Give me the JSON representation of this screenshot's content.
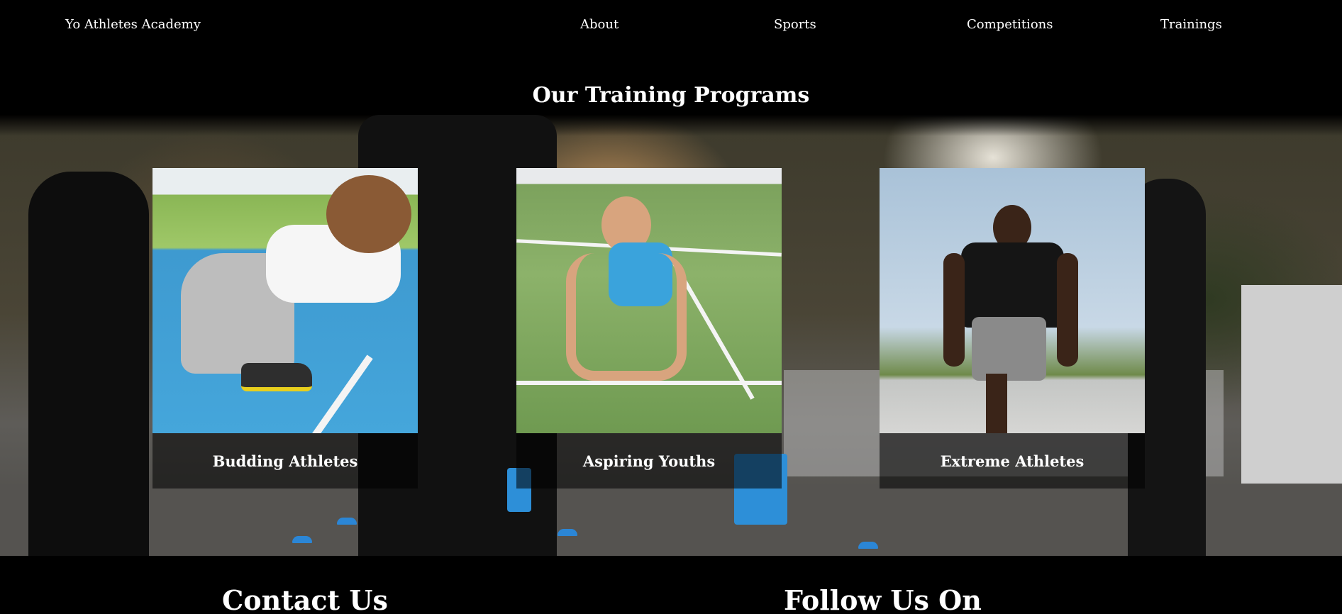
{
  "nav": {
    "brand": "Yo Athletes Academy",
    "links": [
      "About",
      "Sports",
      "Competitions",
      "Trainings"
    ]
  },
  "programs": {
    "title": "Our Training Programs",
    "cards": [
      {
        "label": "Budding Athletes"
      },
      {
        "label": "Aspiring Youths"
      },
      {
        "label": "Extreme Athletes"
      }
    ]
  },
  "footer": {
    "contact_title": "Contact Us",
    "follow_title": "Follow Us On"
  }
}
